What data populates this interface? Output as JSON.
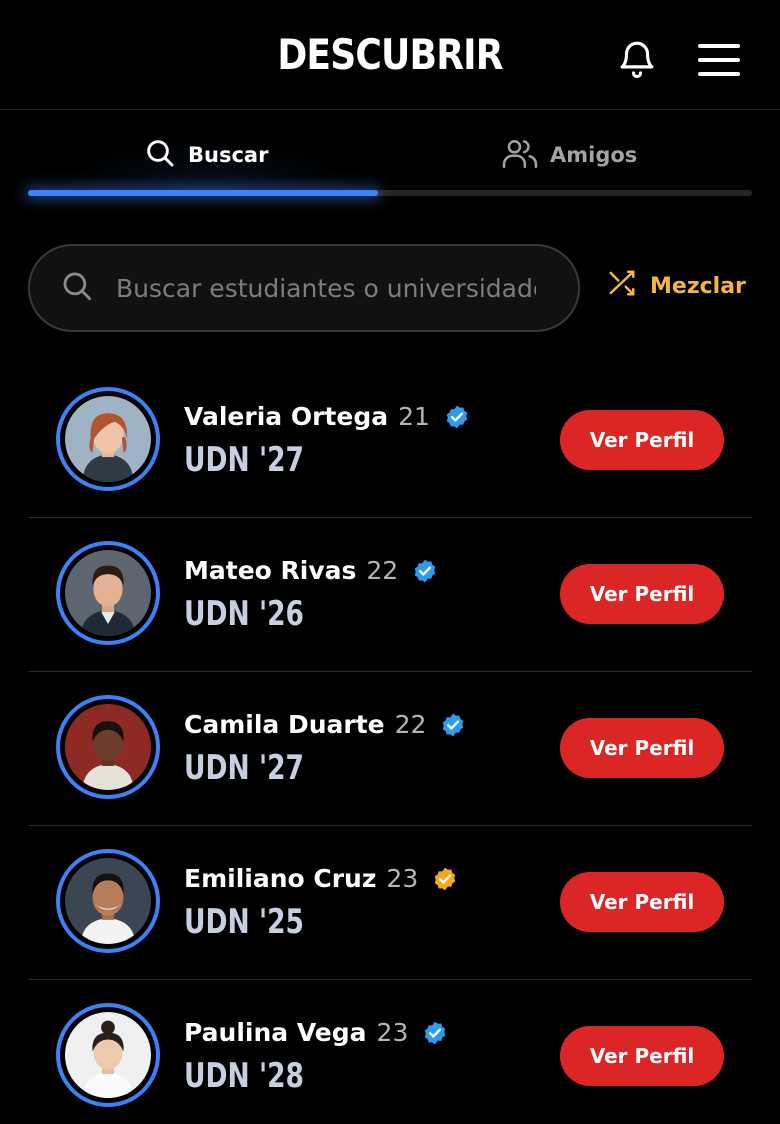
{
  "header": {
    "title": "DESCUBRIR",
    "bell_icon": "bell-icon",
    "menu_icon": "hamburger-menu-icon"
  },
  "tabs": [
    {
      "label": "Buscar",
      "icon": "search-icon",
      "active": true
    },
    {
      "label": "Amigos",
      "icon": "users-icon",
      "active": false
    }
  ],
  "search": {
    "placeholder": "Buscar estudiantes o universidades",
    "value": ""
  },
  "shuffle": {
    "label": "Mezclar",
    "icon": "shuffle-icon"
  },
  "colors": {
    "accent": "#3b82f6",
    "button": "#dc2626",
    "verified_blue": "#2f9bf0",
    "verified_gold": "#f5a623",
    "shuffle": "#f5b63a"
  },
  "students": [
    {
      "name": "Valeria Ortega",
      "age": "21",
      "school": "UDN '27",
      "verified": "blue",
      "action": "Ver Perfil"
    },
    {
      "name": "Mateo Rivas",
      "age": "22",
      "school": "UDN '26",
      "verified": "blue",
      "action": "Ver Perfil"
    },
    {
      "name": "Camila Duarte",
      "age": "22",
      "school": "UDN '27",
      "verified": "blue",
      "action": "Ver Perfil"
    },
    {
      "name": "Emiliano Cruz",
      "age": "23",
      "school": "UDN '25",
      "verified": "gold",
      "action": "Ver Perfil"
    },
    {
      "name": "Paulina Vega",
      "age": "23",
      "school": "UDN '28",
      "verified": "blue",
      "action": "Ver Perfil"
    }
  ]
}
